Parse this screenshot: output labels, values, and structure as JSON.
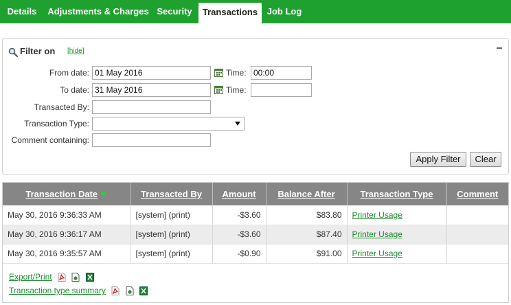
{
  "tabs": [
    {
      "label": "Details",
      "active": false
    },
    {
      "label": "Adjustments & Charges",
      "active": false
    },
    {
      "label": "Security",
      "active": false
    },
    {
      "label": "Transactions",
      "active": true
    },
    {
      "label": "Job Log",
      "active": false
    }
  ],
  "filter": {
    "title": "Filter on",
    "hide_label": "hide",
    "from_date_label": "From date:",
    "from_date_value": "01 May 2016",
    "from_time_label": "Time:",
    "from_time_value": "00:00",
    "to_date_label": "To date:",
    "to_date_value": "31 May 2016",
    "to_time_label": "Time:",
    "to_time_value": "",
    "transacted_by_label": "Transacted By:",
    "transacted_by_value": "",
    "transaction_type_label": "Transaction Type:",
    "transaction_type_value": "",
    "comment_label": "Comment containing:",
    "comment_value": "",
    "apply_label": "Apply Filter",
    "clear_label": "Clear"
  },
  "table": {
    "columns": [
      "Transaction Date",
      "Transacted By",
      "Amount",
      "Balance After",
      "Transaction Type",
      "Comment"
    ],
    "rows": [
      {
        "date": "May 30, 2016 9:36:33 AM",
        "by": "[system] (print)",
        "amount": "-$3.60",
        "balance": "$83.80",
        "type": "Printer Usage",
        "comment": ""
      },
      {
        "date": "May 30, 2016 9:36:17 AM",
        "by": "[system] (print)",
        "amount": "-$3.60",
        "balance": "$87.40",
        "type": "Printer Usage",
        "comment": ""
      },
      {
        "date": "May 30, 2016 9:35:57 AM",
        "by": "[system] (print)",
        "amount": "-$0.90",
        "balance": "$91.00",
        "type": "Printer Usage",
        "comment": ""
      }
    ]
  },
  "export": {
    "export_print_label": "Export/Print",
    "summary_label": "Transaction type summary"
  },
  "colors": {
    "brand_green": "#1fa12f",
    "link_green": "#1a8d2c",
    "header_gray": "#868686",
    "row_alt": "#ececec"
  },
  "icons": {
    "filter": "magnifier-icon",
    "calendar": "calendar-icon",
    "pdf": "pdf-icon",
    "html": "html-doc-icon",
    "excel": "excel-icon"
  }
}
